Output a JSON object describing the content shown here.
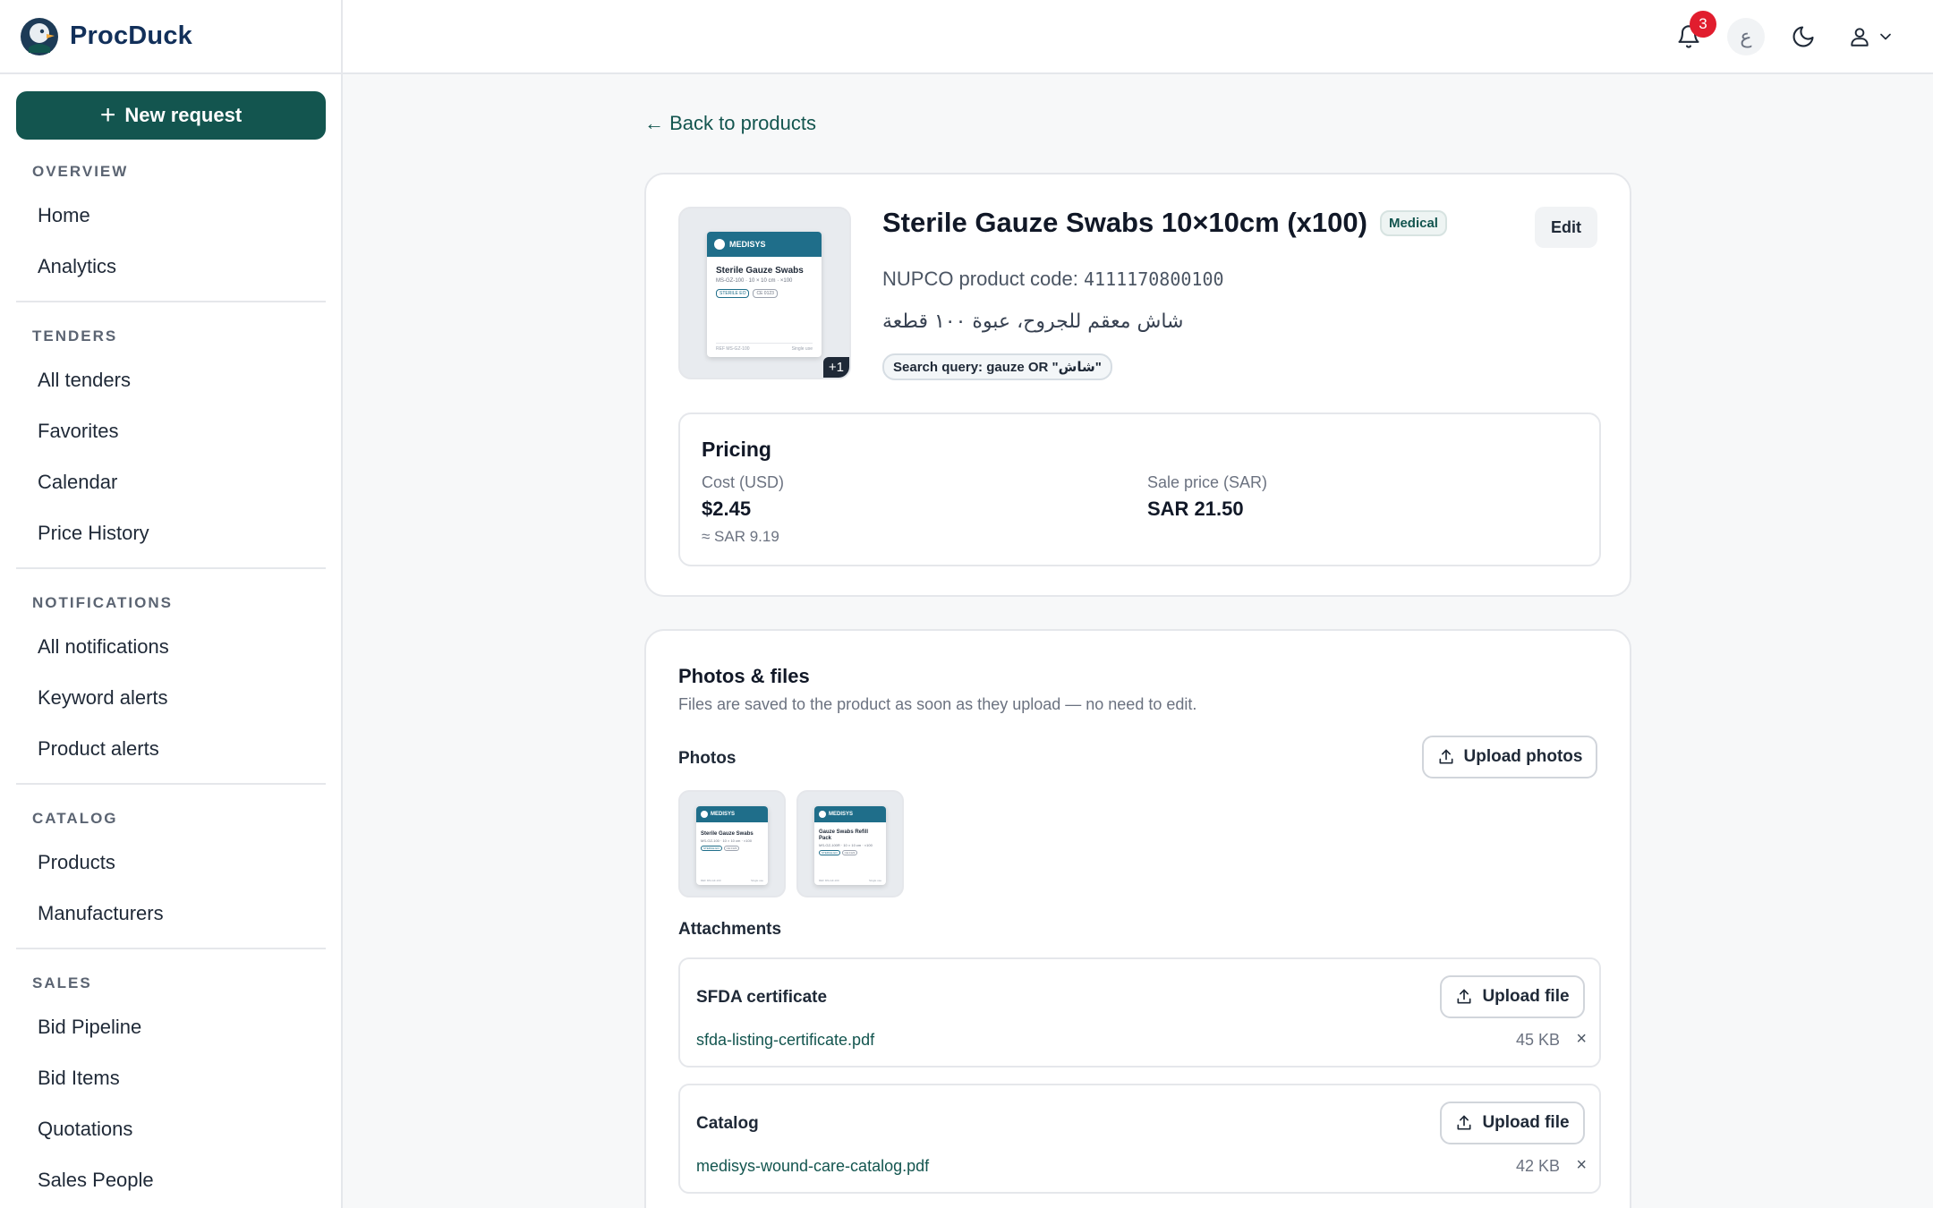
{
  "brand": {
    "name": "ProcDuck",
    "icon": "duck-logo-icon"
  },
  "sidebar": {
    "new_request_label": "New request",
    "sections": [
      {
        "heading": "OVERVIEW",
        "items": [
          "Home",
          "Analytics"
        ]
      },
      {
        "heading": "TENDERS",
        "items": [
          "All tenders",
          "Favorites",
          "Calendar",
          "Price History"
        ]
      },
      {
        "heading": "NOTIFICATIONS",
        "items": [
          "All notifications",
          "Keyword alerts",
          "Product alerts"
        ]
      },
      {
        "heading": "CATALOG",
        "items": [
          "Products",
          "Manufacturers"
        ]
      },
      {
        "heading": "SALES",
        "items": [
          "Bid Pipeline",
          "Bid Items",
          "Quotations",
          "Sales People"
        ]
      }
    ]
  },
  "header": {
    "notification_count": "3",
    "language_toggle": "ع",
    "icons": [
      "bell-icon",
      "language-icon",
      "moon-icon",
      "user-icon",
      "chevron-down-icon"
    ]
  },
  "main": {
    "back_link": "← Back to products",
    "product": {
      "title": "Sterile Gauze Swabs 10×10cm (x100)",
      "category": "Medical",
      "edit_label": "Edit",
      "code_label": "NUPCO product code:",
      "code_value": "4111170800100",
      "arabic_description": "شاش معقم للجروح، عبوة ١٠٠ قطعة",
      "search_query": "Search query: gauze OR \"شاش\"",
      "thumb_more": "+1",
      "thumb_brand": "MEDISYS",
      "thumb_name": "Sterile Gauze Swabs",
      "thumb_line": "MS-GZ-100 · 10 × 10 cm · ×100",
      "thumb_tags": [
        "STERILE EO",
        "CE 0123"
      ],
      "thumb_footer_left": "REF MS-GZ-100",
      "thumb_footer_right": "Single use",
      "photo2_name": "Gauze Swabs Refill Pack",
      "photo2_line": "MS-GZ-100R · 10 × 10 cm · ×100"
    },
    "pricing": {
      "title": "Pricing",
      "cost_label": "Cost (USD)",
      "cost_value": "$2.45",
      "cost_converted": "≈ SAR 9.19",
      "sale_label": "Sale price (SAR)",
      "sale_value": "SAR 21.50"
    },
    "files": {
      "title": "Photos & files",
      "subtitle": "Files are saved to the product as soon as they upload — no need to edit.",
      "photos_heading": "Photos",
      "upload_photos_label": "Upload photos",
      "attachments_heading": "Attachments",
      "attachments": [
        {
          "name": "SFDA certificate",
          "upload_label": "Upload file",
          "file": "sfda-listing-certificate.pdf",
          "size": "45 KB",
          "remove": "×"
        },
        {
          "name": "Catalog",
          "upload_label": "Upload file",
          "file": "medisys-wound-care-catalog.pdf",
          "size": "42 KB",
          "remove": "×"
        }
      ]
    }
  },
  "colors": {
    "accent": "#13554f",
    "badge": "#e11d2e",
    "brand_text": "#12305a",
    "product_header": "#1f6e8a"
  }
}
